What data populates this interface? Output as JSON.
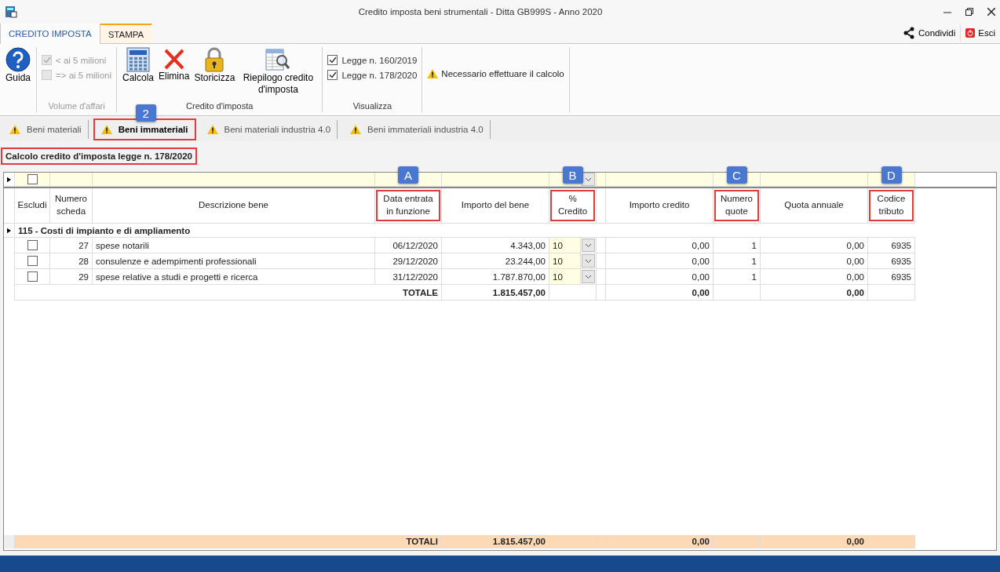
{
  "window": {
    "title": "Credito imposta beni strumentali -  Ditta GB999S - Anno 2020"
  },
  "ribbon_tabs": [
    {
      "label": "CREDITO IMPOSTA",
      "selected": true,
      "kind": "standard"
    },
    {
      "label": "STAMPA",
      "selected": false,
      "kind": "contextual"
    }
  ],
  "ribbon_actions": [
    {
      "label": "Condividi",
      "kind": "share"
    },
    {
      "label": "Esci",
      "kind": "exit"
    }
  ],
  "ribbon_groups": [
    {
      "items": [
        {
          "kind": "button",
          "label": "Guida"
        }
      ]
    },
    {
      "label": "Volume d'affari",
      "items": [
        {
          "kind": "checkbox",
          "label": "< ai 5 milioni",
          "checked": true,
          "disabled": true
        },
        {
          "kind": "checkbox",
          "label": "=> ai 5 milioni",
          "checked": false,
          "disabled": true
        }
      ]
    },
    {
      "label": "Credito d'imposta",
      "items": [
        {
          "kind": "button",
          "label": "Calcola"
        },
        {
          "kind": "button",
          "label": "Elimina"
        },
        {
          "kind": "button",
          "label": "Storicizza"
        },
        {
          "kind": "button",
          "label": "Riepilogo credito d'imposta"
        }
      ]
    },
    {
      "label": "Visualizza",
      "items": [
        {
          "kind": "checkbox",
          "label": "Legge n. 160/2019",
          "checked": true,
          "disabled": false
        },
        {
          "kind": "checkbox",
          "label": "Legge n. 178/2020",
          "checked": true,
          "disabled": false
        }
      ]
    },
    {
      "items": [
        {
          "kind": "warning",
          "label": "Necessario effettuare il calcolo"
        }
      ]
    }
  ],
  "sheet_tabs": [
    {
      "label": "Beni materiali",
      "selected": false,
      "highlighted": false
    },
    {
      "label": "Beni immateriali",
      "selected": true,
      "highlighted": true,
      "badge": "2"
    },
    {
      "label": "Beni materiali industria 4.0",
      "selected": false,
      "highlighted": false
    },
    {
      "label": "Beni immateriali industria 4.0",
      "selected": false,
      "highlighted": false
    }
  ],
  "section_title": {
    "text": "Calcolo credito d'imposta legge n. 178/2020",
    "highlighted": true
  },
  "grid": {
    "filter_checked": false,
    "columns": [
      {
        "label": "Escludi",
        "highlighted": false
      },
      {
        "label": "Numero scheda",
        "highlighted": false
      },
      {
        "label": "Descrizione bene",
        "highlighted": false
      },
      {
        "label": "Data entrata in funzione",
        "highlighted": true,
        "badge": "A"
      },
      {
        "label": "Importo del bene",
        "highlighted": false
      },
      {
        "label": "% Credito",
        "highlighted": true,
        "badge": "B"
      },
      {
        "label": "Importo credito",
        "highlighted": false
      },
      {
        "label": "Numero quote",
        "highlighted": true,
        "badge": "C"
      },
      {
        "label": "Quota annuale",
        "highlighted": false
      },
      {
        "label": "Codice tributo",
        "highlighted": true,
        "badge": "D"
      }
    ],
    "groups": [
      {
        "label": "115 - Costi di impianto e di ampliamento",
        "expanded": true,
        "rows": [
          {
            "excluded": false,
            "number": "27",
            "description": "spese notarili",
            "date": "06/12/2020",
            "amount": "4.343,00",
            "percent": "10",
            "credit": "0,00",
            "installments": "1",
            "annual": "0,00",
            "code": "6935"
          },
          {
            "excluded": false,
            "number": "28",
            "description": "consulenze e adempimenti professionali",
            "date": "29/12/2020",
            "amount": "23.244,00",
            "percent": "10",
            "credit": "0,00",
            "installments": "1",
            "annual": "0,00",
            "code": "6935"
          },
          {
            "excluded": false,
            "number": "29",
            "description": "spese relative a studi e progetti e ricerca",
            "date": "31/12/2020",
            "amount": "1.787.870,00",
            "percent": "10",
            "credit": "0,00",
            "installments": "1",
            "annual": "0,00",
            "code": "6935"
          }
        ]
      }
    ],
    "total": {
      "label": "TOTALE",
      "amount": "1.815.457,00",
      "credit": "0,00",
      "annual": "0,00"
    },
    "footer": {
      "label": "TOTALI",
      "amount": "1.815.457,00",
      "credit": "0,00",
      "annual": "0,00"
    }
  }
}
